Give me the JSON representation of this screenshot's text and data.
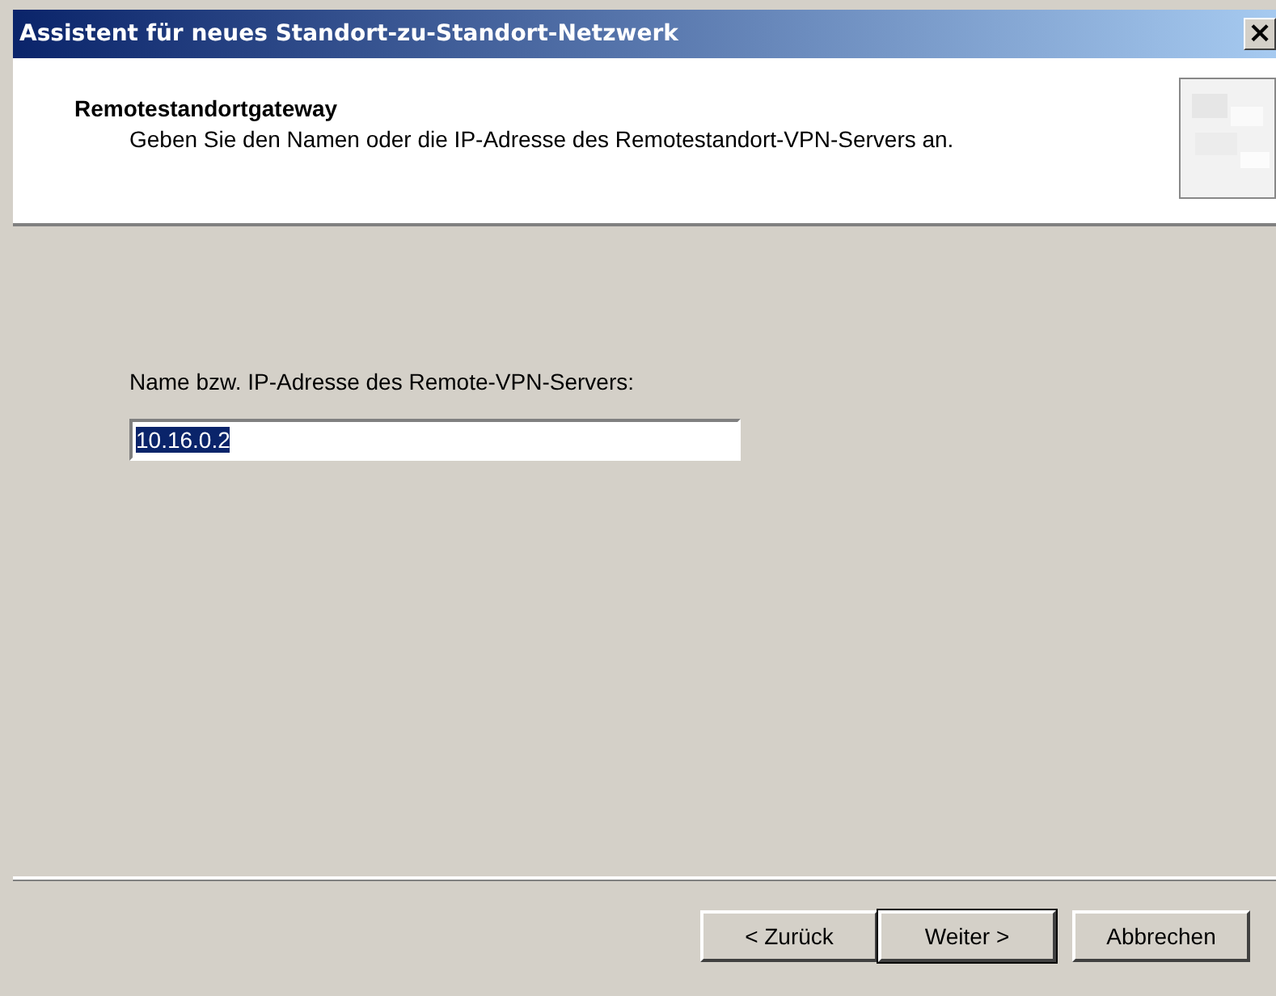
{
  "window": {
    "title": "Assistent für neues Standort-zu-Standort-Netzwerk",
    "close_glyph": "×"
  },
  "header": {
    "title": "Remotestandortgateway",
    "subtitle": "Geben Sie den Namen oder die IP-Adresse des Remotestandort-VPN-Servers an."
  },
  "field": {
    "label": "Name bzw. IP-Adresse des Remote-VPN-Servers:",
    "value": "10.16.0.2"
  },
  "buttons": [
    {
      "label": "< Zurück",
      "default": false
    },
    {
      "label": "Weiter >",
      "default": true
    },
    {
      "label": "Abbrechen",
      "default": false
    }
  ]
}
